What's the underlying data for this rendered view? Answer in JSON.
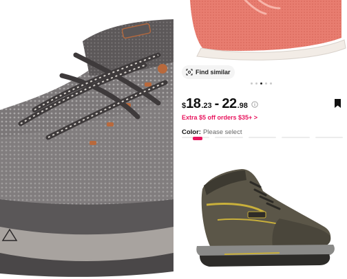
{
  "product": {
    "find_similar_label": "Find similar",
    "price": {
      "currency": "$",
      "low_int": "18",
      "low_dec": ".23",
      "separator": "-",
      "high_int": "22",
      "high_dec": ".98"
    },
    "promo_text": "Extra $5 off orders $35+ >",
    "color_label": "Color:",
    "color_value": "Please select"
  },
  "carousel": {
    "count": 5,
    "active_index": 2
  },
  "icons": {
    "find_similar": "camera-scan-icon",
    "info": "info-icon",
    "bookmark": "bookmark-icon"
  },
  "colors": {
    "promo": "#e8145d",
    "top_shoe": "#e9766a",
    "left_shoe": "#6e6a6b",
    "boot": "#5b5648"
  }
}
